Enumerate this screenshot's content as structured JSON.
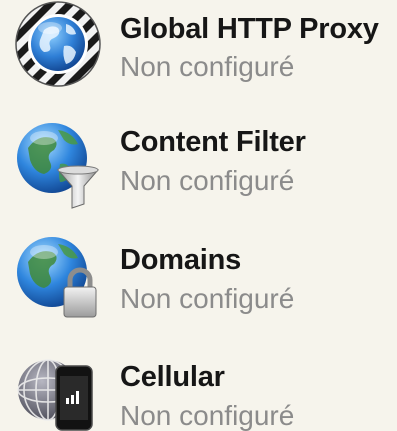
{
  "payloads": [
    {
      "title": "Global HTTP Proxy",
      "status": "Non configuré",
      "icon": "globe-proxy-icon"
    },
    {
      "title": "Content Filter",
      "status": "Non configuré",
      "icon": "globe-filter-icon"
    },
    {
      "title": "Domains",
      "status": "Non configuré",
      "icon": "globe-lock-icon"
    },
    {
      "title": "Cellular",
      "status": "Non configuré",
      "icon": "cellular-phone-icon"
    }
  ],
  "colors": {
    "background": "#f6f4ec",
    "title": "#161616",
    "status": "#8b8b8b",
    "globe": "#2f7fd6"
  }
}
